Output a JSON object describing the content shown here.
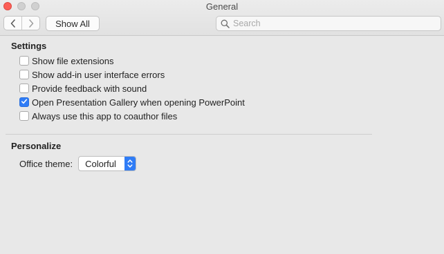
{
  "window": {
    "title": "General",
    "controls": [
      "close",
      "minimize",
      "zoom"
    ]
  },
  "toolbar": {
    "back_icon": "chevron-left-icon",
    "forward_icon": "chevron-right-icon",
    "show_all_label": "Show All",
    "search": {
      "placeholder": "Search",
      "value": "",
      "icon": "magnifier-icon"
    }
  },
  "settings": {
    "title": "Settings",
    "options": [
      {
        "label": "Show file extensions",
        "checked": false
      },
      {
        "label": "Show add-in user interface errors",
        "checked": false
      },
      {
        "label": "Provide feedback with sound",
        "checked": false
      },
      {
        "label": "Open Presentation Gallery when opening PowerPoint",
        "checked": true
      },
      {
        "label": "Always use this app to coauthor files",
        "checked": false
      }
    ]
  },
  "personalize": {
    "title": "Personalize",
    "theme_label": "Office theme:",
    "theme_value": "Colorful"
  },
  "colors": {
    "accent": "#2f7cf6",
    "close_button": "#fc5f57",
    "background": "#e8e8e8"
  }
}
